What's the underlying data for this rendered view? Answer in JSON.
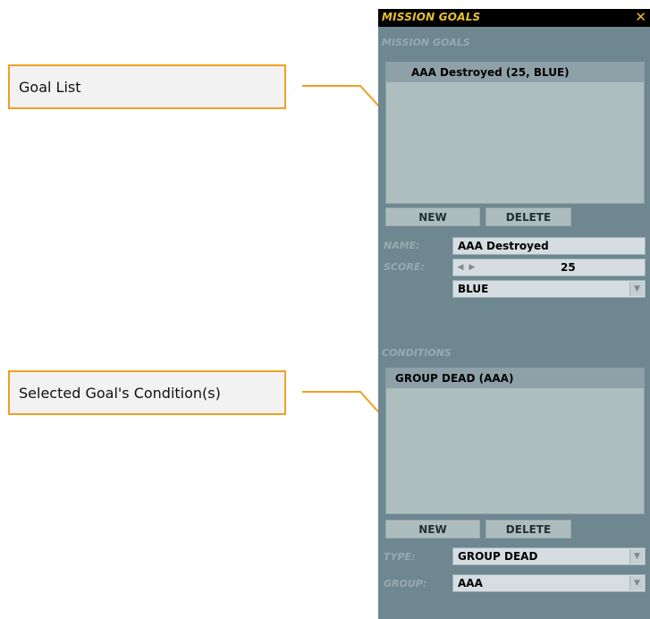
{
  "callouts": {
    "goal_list": "Goal List",
    "conditions": "Selected Goal's Condition(s)"
  },
  "panel": {
    "title": "MISSION GOALS",
    "close_glyph": "✕",
    "goals_section": "MISSION GOALS",
    "goals": [
      "AAA Destroyed (25, BLUE)"
    ],
    "new_label": "NEW",
    "delete_label": "DELETE",
    "name_label": "NAME:",
    "name_value": "AAA Destroyed",
    "score_label": "SCORE:",
    "score_value": "25",
    "side_value": "BLUE",
    "conditions_section": "CONDITIONS",
    "conditions": [
      "GROUP DEAD (AAA)"
    ],
    "cond_new_label": "NEW",
    "cond_delete_label": "DELETE",
    "type_label": "TYPE:",
    "type_value": "GROUP DEAD",
    "group_label": "GROUP:",
    "group_value": "AAA"
  },
  "colors": {
    "callout_border": "#f0a020",
    "panel_bg": "#6e8790",
    "title_text": "#e8c030"
  },
  "icons": {
    "close": "close-icon",
    "dropdown": "chevron-down-icon",
    "spin_left": "chevron-left-icon",
    "spin_right": "chevron-right-icon"
  }
}
